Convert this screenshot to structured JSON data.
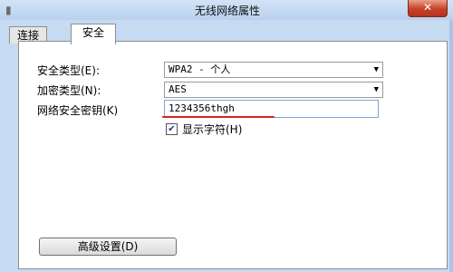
{
  "window": {
    "title": "无线网络属性",
    "close_glyph": "✕"
  },
  "tabs": [
    {
      "label": "连接",
      "active": false
    },
    {
      "label": "安全",
      "active": true
    }
  ],
  "security": {
    "type_label": "安全类型(E):",
    "type_value": "WPA2 - 个人",
    "encryption_label": "加密类型(N):",
    "encryption_value": "AES",
    "key_label": "网络安全密钥(K)",
    "key_value": "1234356thgh",
    "show_chars_label": "显示字符(H)",
    "show_chars_checked": true
  },
  "advanced_button": "高级设置(D)",
  "colors": {
    "underline": "#d8241c",
    "titlebar": "#c6daf1"
  }
}
